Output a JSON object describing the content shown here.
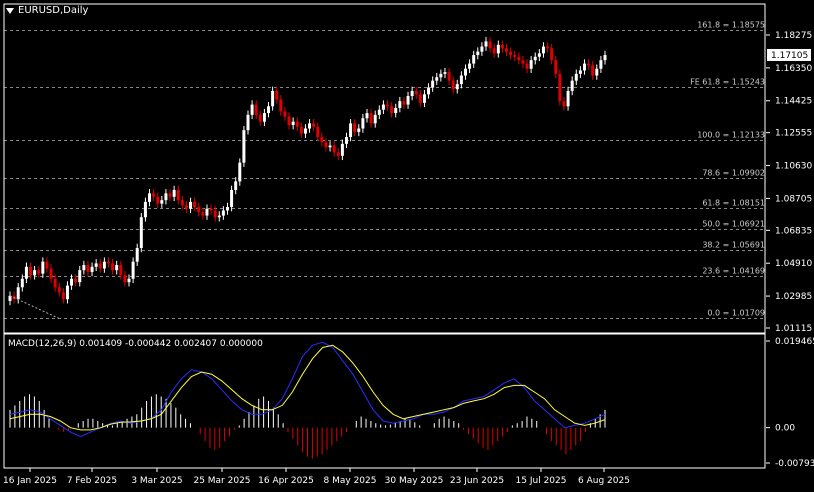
{
  "window": {
    "symbol_title": "EURUSD,Daily"
  },
  "macd": {
    "label": "MACD(12,26,9) 0.001409 -0.000442 0.002407 0.000000",
    "axis_labels": [
      "0.019465",
      "0.00",
      "-0.007939"
    ]
  },
  "price_axis": {
    "labels": [
      "1.18275",
      "1.16350",
      "1.14425",
      "1.12555",
      "1.10630",
      "1.08705",
      "1.06835",
      "1.04910",
      "1.02985",
      "1.01115"
    ],
    "current_price": "1.17105"
  },
  "fib_levels": [
    {
      "label": "161.8 = 1.18575",
      "value": 1.18575
    },
    {
      "label": "FE 61.8 = 1.15243",
      "value": 1.15243
    },
    {
      "label": "100.0 = 1.12133",
      "value": 1.12133
    },
    {
      "label": "78.6 = 1.09902",
      "value": 1.09902
    },
    {
      "label": "61.8 = 1.08151",
      "value": 1.08151
    },
    {
      "label": "50.0 = 1.06921",
      "value": 1.06921
    },
    {
      "label": "38.2 = 1.05691",
      "value": 1.05691
    },
    {
      "label": "23.6 = 1.04169",
      "value": 1.04169
    },
    {
      "label": "0.0 = 1.01709",
      "value": 1.01709
    }
  ],
  "date_axis": {
    "labels": [
      "16 Jan 2025",
      "7 Feb 2025",
      "3 Mar 2025",
      "25 Mar 2025",
      "16 Apr 2025",
      "8 May 2025",
      "30 May 2025",
      "23 Jun 2025",
      "15 Jul 2025",
      "6 Aug 2025"
    ]
  },
  "colors": {
    "bull": "#ffffff",
    "bear": "#e00000",
    "macd_line": "#2b2bff",
    "signal_line": "#ffff40",
    "grid": "#888888",
    "bg": "#000000"
  },
  "chart_data": {
    "type": "candlestick",
    "price_scale": {
      "min": 1.01115,
      "max": 1.18275
    },
    "closes": [
      1.03,
      1.028,
      1.035,
      1.04,
      1.047,
      1.042,
      1.045,
      1.043,
      1.05,
      1.046,
      1.04,
      1.035,
      1.032,
      1.028,
      1.036,
      1.04,
      1.038,
      1.045,
      1.048,
      1.044,
      1.047,
      1.049,
      1.046,
      1.05,
      1.049,
      1.045,
      1.048,
      1.042,
      1.038,
      1.04,
      1.05,
      1.058,
      1.076,
      1.085,
      1.09,
      1.088,
      1.084,
      1.086,
      1.09,
      1.088,
      1.092,
      1.086,
      1.083,
      1.081,
      1.085,
      1.082,
      1.079,
      1.077,
      1.081,
      1.08,
      1.076,
      1.077,
      1.08,
      1.082,
      1.092,
      1.097,
      1.108,
      1.127,
      1.136,
      1.142,
      1.136,
      1.132,
      1.137,
      1.141,
      1.15,
      1.145,
      1.138,
      1.135,
      1.13,
      1.132,
      1.129,
      1.125,
      1.128,
      1.131,
      1.129,
      1.123,
      1.12,
      1.117,
      1.118,
      1.114,
      1.112,
      1.119,
      1.123,
      1.131,
      1.126,
      1.128,
      1.134,
      1.137,
      1.131,
      1.136,
      1.139,
      1.142,
      1.141,
      1.137,
      1.14,
      1.144,
      1.142,
      1.147,
      1.15,
      1.148,
      1.143,
      1.148,
      1.152,
      1.156,
      1.158,
      1.16,
      1.161,
      1.156,
      1.151,
      1.154,
      1.159,
      1.163,
      1.166,
      1.171,
      1.173,
      1.176,
      1.179,
      1.175,
      1.172,
      1.177,
      1.175,
      1.173,
      1.171,
      1.17,
      1.168,
      1.166,
      1.163,
      1.168,
      1.17,
      1.172,
      1.176,
      1.175,
      1.168,
      1.16,
      1.144,
      1.141,
      1.15,
      1.156,
      1.16,
      1.162,
      1.166,
      1.165,
      1.159,
      1.163,
      1.168,
      1.171
    ],
    "macd_histogram": [
      0.004,
      0.005,
      0.006,
      0.007,
      0.0075,
      0.007,
      0.006,
      0.004,
      0.002,
      0.0,
      -0.0005,
      -0.001,
      -0.0005,
      0.0,
      0.001,
      0.0015,
      0.002,
      0.002,
      0.0015,
      0.001,
      0.0005,
      0.0005,
      0.001,
      0.0015,
      0.002,
      0.0025,
      0.003,
      0.0045,
      0.006,
      0.007,
      0.0075,
      0.007,
      0.0065,
      0.0055,
      0.0045,
      0.003,
      0.002,
      0.001,
      0.0,
      -0.0015,
      -0.003,
      -0.0045,
      -0.005,
      -0.0045,
      -0.003,
      -0.002,
      -0.0005,
      0.0005,
      0.002,
      0.0035,
      0.005,
      0.0065,
      0.007,
      0.006,
      0.0045,
      0.003,
      0.001,
      -0.001,
      -0.0025,
      -0.004,
      -0.0055,
      -0.0065,
      -0.007,
      -0.0065,
      -0.006,
      -0.005,
      -0.004,
      -0.003,
      -0.002,
      -0.001,
      0.0,
      0.0015,
      0.0025,
      0.002,
      0.0015,
      0.001,
      0.0007,
      0.0005,
      0.0007,
      0.0012,
      0.0015,
      0.002,
      0.0018,
      0.0012,
      0.0005,
      0.0,
      0.0,
      0.001,
      0.002,
      0.0025,
      0.002,
      0.0015,
      0.001,
      -0.0005,
      -0.0015,
      -0.0025,
      -0.0035,
      -0.0045,
      -0.005,
      -0.004,
      -0.003,
      -0.002,
      -0.001,
      0.0005,
      0.001,
      0.0015,
      0.0025,
      0.002,
      0.0015,
      0.0,
      -0.0015,
      -0.003,
      -0.004,
      -0.005,
      -0.006,
      -0.005,
      -0.004,
      -0.003,
      -0.001,
      0.001,
      0.002,
      0.003,
      0.004
    ],
    "macd_line": [
      0.003,
      0.0035,
      0.004,
      0.0035,
      0.002,
      0.0005,
      -0.001,
      -0.002,
      -0.001,
      0.0,
      0.001,
      0.0015,
      0.001,
      0.0015,
      0.002,
      0.004,
      0.008,
      0.011,
      0.013,
      0.0125,
      0.011,
      0.0085,
      0.006,
      0.004,
      0.003,
      0.003,
      0.004,
      0.0065,
      0.011,
      0.016,
      0.0185,
      0.0192,
      0.018,
      0.015,
      0.012,
      0.008,
      0.004,
      0.0015,
      0.001,
      0.0015,
      0.002,
      0.003,
      0.003,
      0.0035,
      0.0045,
      0.006,
      0.0065,
      0.007,
      0.0085,
      0.01,
      0.011,
      0.009,
      0.006,
      0.004,
      0.002,
      0.0,
      0.0005,
      0.001,
      0.002,
      0.003
    ],
    "signal_line": [
      0.002,
      0.0025,
      0.003,
      0.003,
      0.0025,
      0.0015,
      0.0,
      -0.0005,
      -0.0005,
      0.0,
      0.0008,
      0.0012,
      0.0013,
      0.0015,
      0.002,
      0.003,
      0.006,
      0.009,
      0.0115,
      0.0125,
      0.012,
      0.0105,
      0.0085,
      0.0065,
      0.005,
      0.004,
      0.004,
      0.005,
      0.008,
      0.012,
      0.0155,
      0.018,
      0.0185,
      0.017,
      0.0145,
      0.0115,
      0.008,
      0.005,
      0.003,
      0.002,
      0.0025,
      0.003,
      0.0035,
      0.004,
      0.0045,
      0.0055,
      0.006,
      0.0065,
      0.0075,
      0.009,
      0.0095,
      0.0095,
      0.008,
      0.0065,
      0.004,
      0.0025,
      0.001,
      0.0005,
      0.001,
      0.0018
    ],
    "macd_scale": {
      "min": -0.007939,
      "max": 0.019465
    }
  }
}
